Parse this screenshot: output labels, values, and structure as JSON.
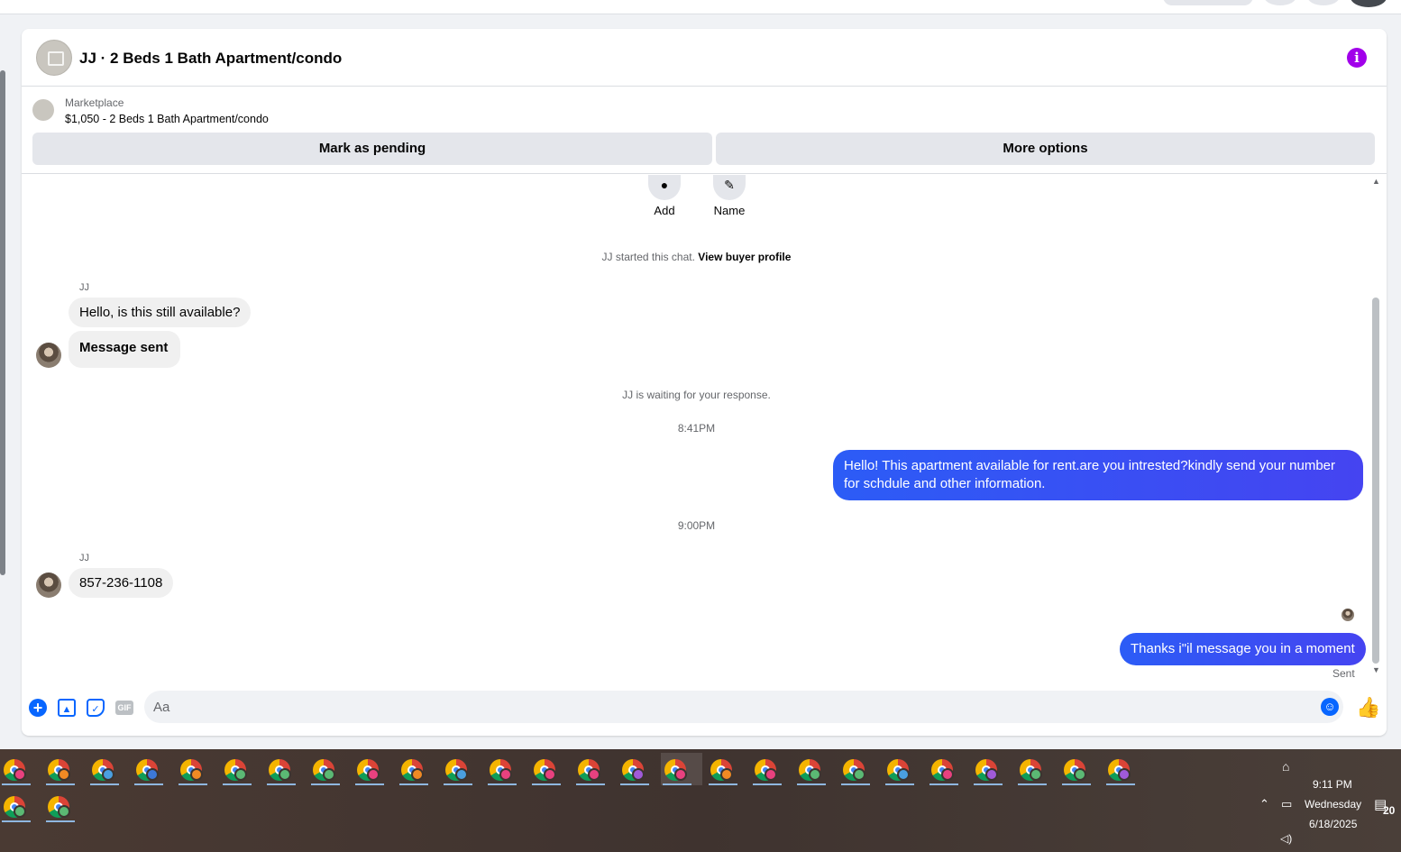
{
  "header": {
    "title": "JJ · 2 Beds 1 Bath Apartment/condo",
    "info_icon": "i"
  },
  "listing": {
    "category": "Marketplace",
    "description": "$1,050 - 2 Beds 1 Bath Apartment/condo",
    "mark_pending_label": "Mark as pending",
    "more_options_label": "More options"
  },
  "actions": {
    "add_label": "Add",
    "name_label": "Name"
  },
  "conversation": {
    "started_text": "JJ started this chat.",
    "view_profile_link": "View buyer profile",
    "waiting_text": "JJ is waiting for your response.",
    "time_1": "8:41PM",
    "time_2": "9:00PM",
    "messages": [
      {
        "sender": "JJ",
        "text": "Hello, is this still available?"
      },
      {
        "sender": "JJ",
        "text": "Message sent"
      },
      {
        "sender": "me",
        "text": "Hello! This apartment available for rent.are you intrested?kindly send your number for schdule and other information."
      },
      {
        "sender": "JJ",
        "text": "857-236-1108"
      },
      {
        "sender": "me",
        "text": "Thanks i\"il message you in a moment"
      }
    ],
    "sender_name": "JJ",
    "sent_status": "Sent"
  },
  "composer": {
    "placeholder": "Aa",
    "gif_label": "GIF"
  },
  "taskbar": {
    "time": "9:11 PM",
    "day": "Wednesday",
    "date": "6/18/2025",
    "notification_count": "20",
    "badge_colors": [
      "#e8417f",
      "#f08a24",
      "#4a9fe0",
      "#3c78d8",
      "#f08a24",
      "#5bb974",
      "#5bb974",
      "#5bb974",
      "#e8417f",
      "#f08a24",
      "#4a9fe0",
      "#e8417f",
      "#e8417f",
      "#e8417f",
      "#a05ad8",
      "#e8417f",
      "#f08a24",
      "#e8417f",
      "#5bb974",
      "#5bb974",
      "#4a9fe0",
      "#e8417f",
      "#a05ad8",
      "#5bb974",
      "#5bb974",
      "#a05ad8",
      "#5bb974",
      "#5bb974"
    ]
  }
}
